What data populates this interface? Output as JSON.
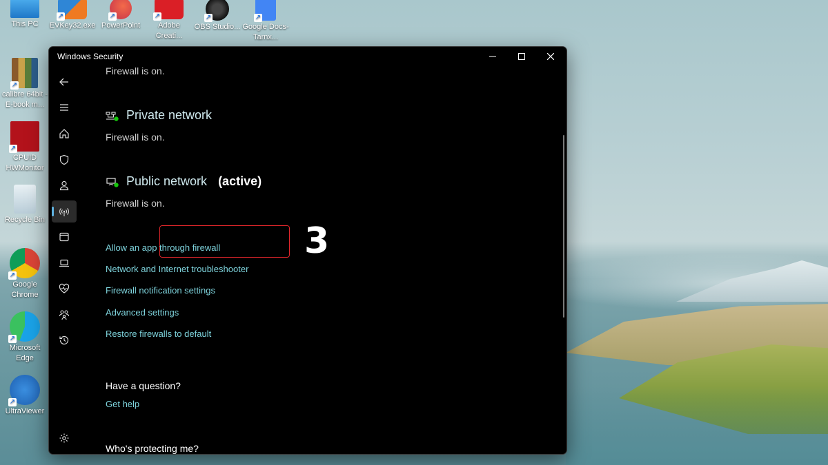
{
  "desktop": {
    "icons": [
      {
        "label": "This PC"
      },
      {
        "label": "EVKey32.exe"
      },
      {
        "label": "PowerPoint"
      },
      {
        "label": "Adobe Creati..."
      },
      {
        "label": "OBS Studio..."
      },
      {
        "label": "Google Docs-Tarnx..."
      },
      {
        "label": "calibre 64bit - E-book m..."
      },
      {
        "label": "CPUID HWMonitor"
      },
      {
        "label": "Recycle Bin"
      },
      {
        "label": "Google Chrome"
      },
      {
        "label": "Microsoft Edge"
      },
      {
        "label": "UltraViewer"
      }
    ]
  },
  "window": {
    "title": "Windows Security",
    "controls": {
      "minimize": "—",
      "maximize": "☐",
      "close": "✕"
    }
  },
  "sidebar": {
    "items": [
      {
        "icon": "back-arrow-icon"
      },
      {
        "icon": "hamburger-menu-icon"
      },
      {
        "icon": "home-icon"
      },
      {
        "icon": "shield-icon"
      },
      {
        "icon": "account-icon"
      },
      {
        "icon": "wifi-antenna-icon",
        "active": true
      },
      {
        "icon": "app-browser-control-icon"
      },
      {
        "icon": "laptop-icon"
      },
      {
        "icon": "health-heart-icon"
      },
      {
        "icon": "family-icon"
      },
      {
        "icon": "history-icon"
      },
      {
        "icon": "settings-gear-icon"
      }
    ]
  },
  "main": {
    "domain_status": "Firewall is on.",
    "private": {
      "title": "Private network",
      "status": "Firewall is on."
    },
    "public": {
      "title": "Public network",
      "active_tag": "(active)",
      "status": "Firewall is on."
    },
    "links": [
      "Allow an app through firewall",
      "Network and Internet troubleshooter",
      "Firewall notification settings",
      "Advanced settings",
      "Restore firewalls to default"
    ],
    "step_number": "3",
    "highlight_color": "#e0262b",
    "question": {
      "heading": "Have a question?",
      "link": "Get help"
    },
    "protecting": {
      "heading": "Who's protecting me?"
    }
  },
  "colors": {
    "link": "#7ed3dc",
    "accent": "#5fb2e0",
    "window_bg": "#000000"
  }
}
